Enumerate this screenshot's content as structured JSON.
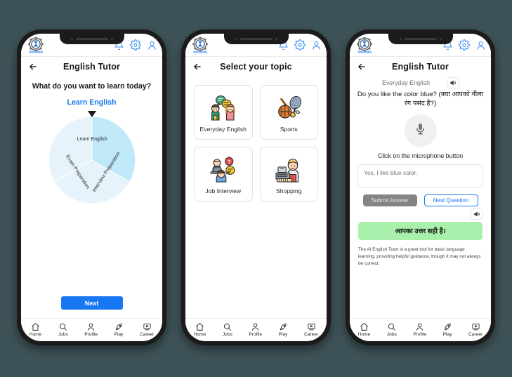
{
  "app": {
    "logo_text": "ShramIN",
    "header_icons": [
      "bell-icon",
      "gear-icon",
      "account-icon"
    ]
  },
  "bottom_nav": [
    {
      "label": "Home",
      "icon": "home-icon"
    },
    {
      "label": "Jobs",
      "icon": "search-icon"
    },
    {
      "label": "Profile",
      "icon": "person-icon"
    },
    {
      "label": "Play",
      "icon": "rocket-icon"
    },
    {
      "label": "Career",
      "icon": "video-screen-icon"
    }
  ],
  "screen1": {
    "title": "English Tutor",
    "prompt": "What do you want to learn today?",
    "link": "Learn English",
    "next_button": "Next",
    "wheel": {
      "segments": [
        {
          "label": "Learn English",
          "color": "#d6c9ef",
          "start_deg": -60,
          "end_deg": 60
        },
        {
          "label": "Interview Preparation",
          "color": "#bfe8f8",
          "start_deg": 60,
          "end_deg": 180
        },
        {
          "label": "Exam Preparation",
          "color": "#e7f3fb",
          "start_deg": 180,
          "end_deg": 300
        }
      ],
      "pointer": "triangle-down"
    }
  },
  "screen2": {
    "title": "Select your topic",
    "cards": [
      {
        "label": "Everyday English",
        "icon": "two-people-talking-icon"
      },
      {
        "label": "Sports",
        "icon": "sports-equipment-icon"
      },
      {
        "label": "Job Interview",
        "icon": "interview-icon"
      },
      {
        "label": "Shopping",
        "icon": "cashier-icon"
      }
    ]
  },
  "screen3": {
    "title": "English Tutor",
    "subtitle": "Everyday English",
    "speaker_icon": "speaker-icon",
    "question": "Do you like the color blue? (क्या आपको नीला रंग पसंद है?)",
    "mic_icon": "microphone-icon",
    "mic_hint": "Click on the microphone button",
    "answer_placeholder": "Yes, I like blue color.",
    "answer_value": "",
    "submit_button": "Submit Answer",
    "next_button": "Next Question",
    "feedback": "आपका उत्तर सही है।",
    "disclaimer": "The AI English Tutor is a great tool for basic language learning, providing helpful guidance, though it may not always be correct."
  },
  "colors": {
    "background": "#3e5358",
    "accent_blue": "#1877f2",
    "feedback_green": "#a9f0ac",
    "disabled_gray": "#848484"
  }
}
